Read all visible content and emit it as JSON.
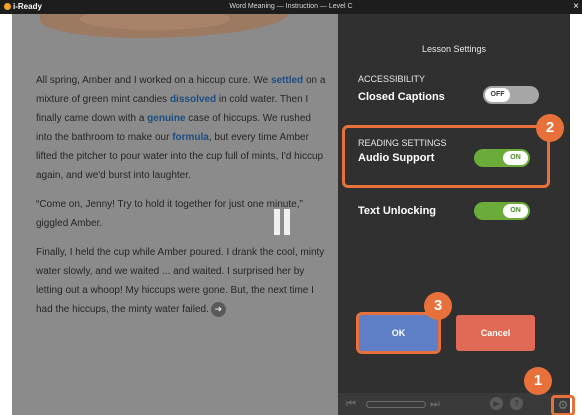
{
  "titlebar": {
    "brand": "i-Ready",
    "window_title": "Word Meaning — Instruction — Level C",
    "close_glyph": "×"
  },
  "story": {
    "p1": {
      "t1": "All spring, Amber and I worked on a hiccup cure. We ",
      "k1": "settled",
      "t2": " on a mixture of green mint candies ",
      "k2": "dissolved",
      "t3": " in cold water. Then I finally came down with a ",
      "k3": "genuine",
      "t4": " case of hiccups. We rushed into the bathroom to make our ",
      "k4": "formula",
      "t5": ", but every time Amber lifted the pitcher to pour water into the cup full of mints, I'd hiccup again, and we'd burst into laughter."
    },
    "p2": "“Come on, Jenny! Try to hold it together for just one minute,” giggled Amber.",
    "p3": "Finally, I held the cup while Amber poured. I drank the cool, minty water slowly, and we waited ... and waited. I surprised her by letting out a whoop! My hiccups were gone. But, the next time I had the hiccups, the minty water failed.",
    "next_glyph": "➜"
  },
  "panel": {
    "title": "Lesson Settings",
    "accessibility_heading": "ACCESSIBILITY",
    "closed_captions_label": "Closed Captions",
    "closed_captions_state": "OFF",
    "reading_heading": "READING SETTINGS",
    "audio_support_label": "Audio Support",
    "audio_support_state": "ON",
    "text_unlocking_label": "Text Unlocking",
    "text_unlocking_state": "ON",
    "ok_label": "OK",
    "cancel_label": "Cancel"
  },
  "controls": {
    "start_glyph": "⏮",
    "end_glyph": "⏭",
    "play_glyph": "▶",
    "help_glyph": "?",
    "gear_glyph": "⚙"
  },
  "callouts": [
    "1",
    "2",
    "3"
  ],
  "colors": {
    "accent": "#e8703a",
    "toggle_on": "#6aab3a",
    "ok_button": "#5e7ec6",
    "cancel_button": "#e06a55",
    "keyword": "#1d4e82"
  }
}
